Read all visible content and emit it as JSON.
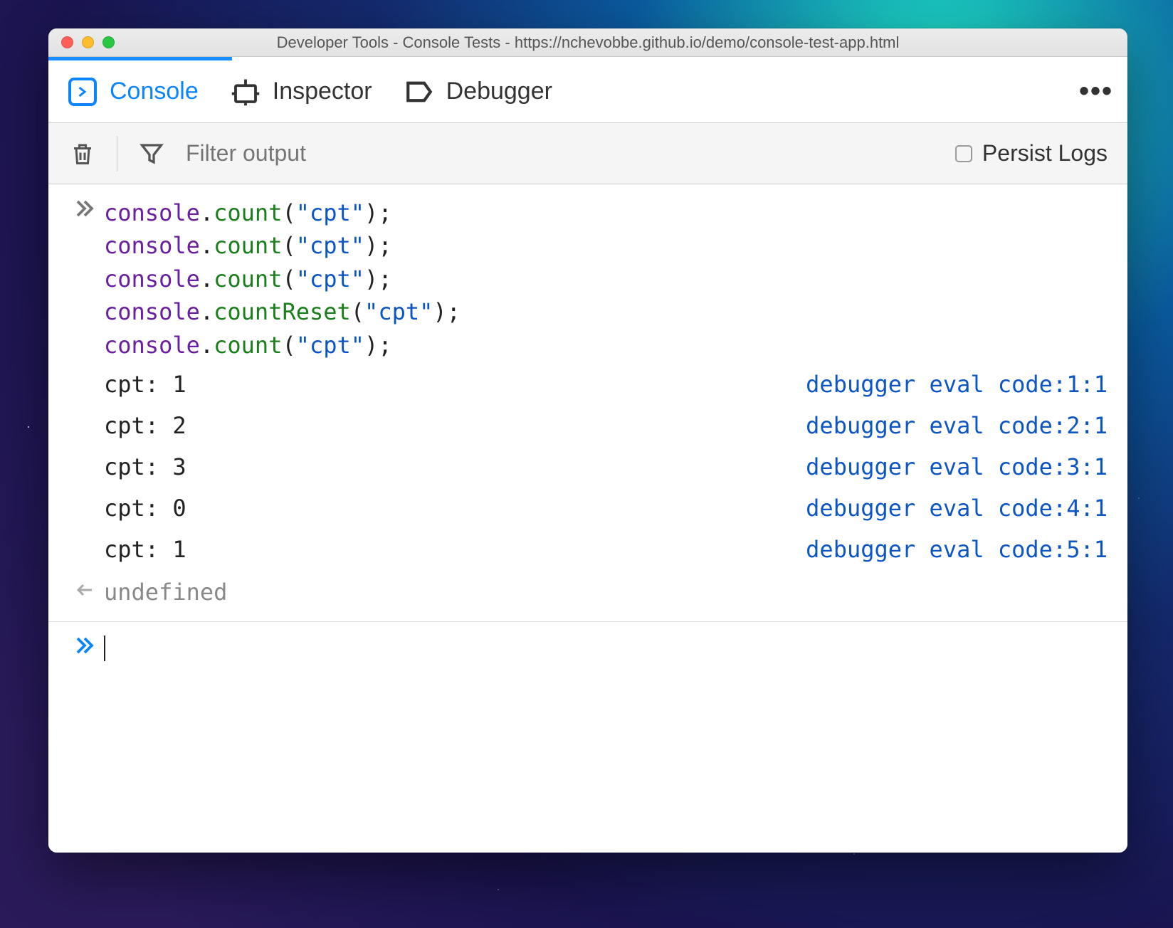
{
  "window": {
    "title": "Developer Tools - Console Tests - https://nchevobbe.github.io/demo/console-test-app.html"
  },
  "tabs": {
    "console": "Console",
    "inspector": "Inspector",
    "debugger": "Debugger"
  },
  "toolbar": {
    "filter_placeholder": "Filter output",
    "persist_label": "Persist Logs"
  },
  "input_code": [
    {
      "obj": "console",
      "fn": "count",
      "arg": "\"cpt\""
    },
    {
      "obj": "console",
      "fn": "count",
      "arg": "\"cpt\""
    },
    {
      "obj": "console",
      "fn": "count",
      "arg": "\"cpt\""
    },
    {
      "obj": "console",
      "fn": "countReset",
      "arg": "\"cpt\""
    },
    {
      "obj": "console",
      "fn": "count",
      "arg": "\"cpt\""
    }
  ],
  "logs": [
    {
      "msg": "cpt: 1",
      "src": "debugger eval code:1:1"
    },
    {
      "msg": "cpt: 2",
      "src": "debugger eval code:2:1"
    },
    {
      "msg": "cpt: 3",
      "src": "debugger eval code:3:1"
    },
    {
      "msg": "cpt: 0",
      "src": "debugger eval code:4:1"
    },
    {
      "msg": "cpt: 1",
      "src": "debugger eval code:5:1"
    }
  ],
  "return_value": "undefined"
}
